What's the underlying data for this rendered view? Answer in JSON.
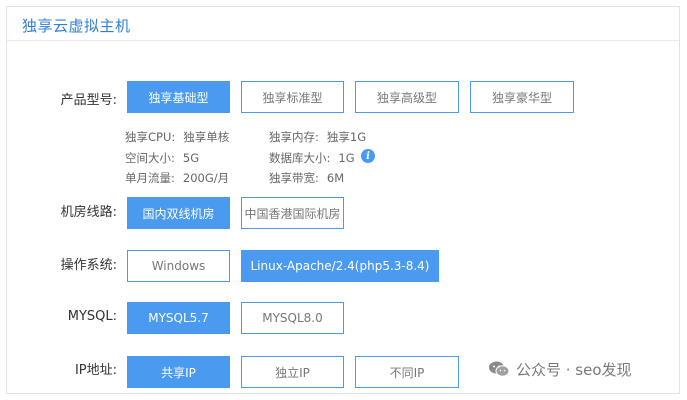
{
  "panel": {
    "title": "独享云虚拟主机"
  },
  "product": {
    "label": "产品型号:",
    "options": [
      "独享基础型",
      "独享标准型",
      "独享高级型",
      "独享豪华型"
    ],
    "selected": 0,
    "specs": {
      "cpu_key": "独享CPU:",
      "cpu_val": "独享单核",
      "mem_key": "独享内存:",
      "mem_val": "独享1G",
      "space_key": "空间大小:",
      "space_val": "5G",
      "db_key": "数据库大小:",
      "db_val": "1G",
      "traffic_key": "单月流量:",
      "traffic_val": "200G/月",
      "bw_key": "独享带宽:",
      "bw_val": "6M"
    }
  },
  "line": {
    "label": "机房线路:",
    "options": [
      "国内双线机房",
      "中国香港国际机房"
    ],
    "selected": 0
  },
  "os": {
    "label": "操作系统:",
    "options": [
      "Windows",
      "Linux-Apache/2.4(php5.3-8.4)"
    ],
    "selected": 1
  },
  "mysql": {
    "label": "MYSQL:",
    "options": [
      "MYSQL5.7",
      "MYSQL8.0"
    ],
    "selected": 0
  },
  "ip": {
    "label": "IP地址:",
    "options": [
      "共享IP",
      "独立IP",
      "不同IP"
    ],
    "selected": 0
  },
  "watermark": {
    "text": "公众号 · seo发现",
    "icon": "wechat-icon"
  },
  "colors": {
    "accent": "#4a9af0",
    "title": "#2f7fd6"
  }
}
